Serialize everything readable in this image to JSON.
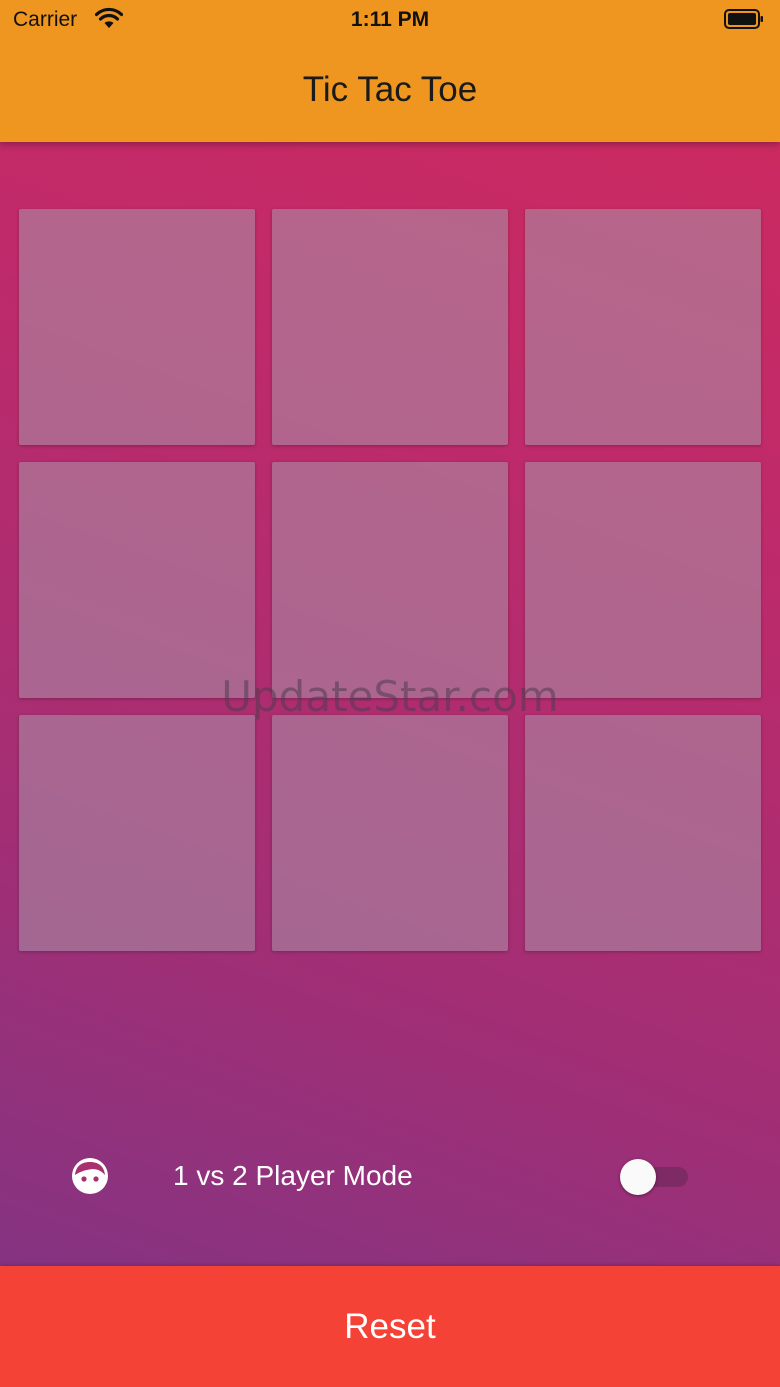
{
  "status_bar": {
    "carrier": "Carrier",
    "time": "1:11 PM",
    "wifi_icon": "wifi-icon",
    "battery_icon": "battery-icon"
  },
  "app_bar": {
    "title": "Tic Tac Toe",
    "color": "#ee961f"
  },
  "board": {
    "cells": [
      "",
      "",
      "",
      "",
      "",
      "",
      "",
      "",
      ""
    ]
  },
  "watermark": "UpdateStar.com",
  "mode": {
    "icon": "face-icon",
    "label": "1 vs 2 Player Mode",
    "two_player_enabled": false
  },
  "reset": {
    "label": "Reset",
    "color": "#f44236"
  },
  "colors": {
    "gradient_top": "#d02a5c",
    "gradient_bottom": "#7d3585"
  }
}
